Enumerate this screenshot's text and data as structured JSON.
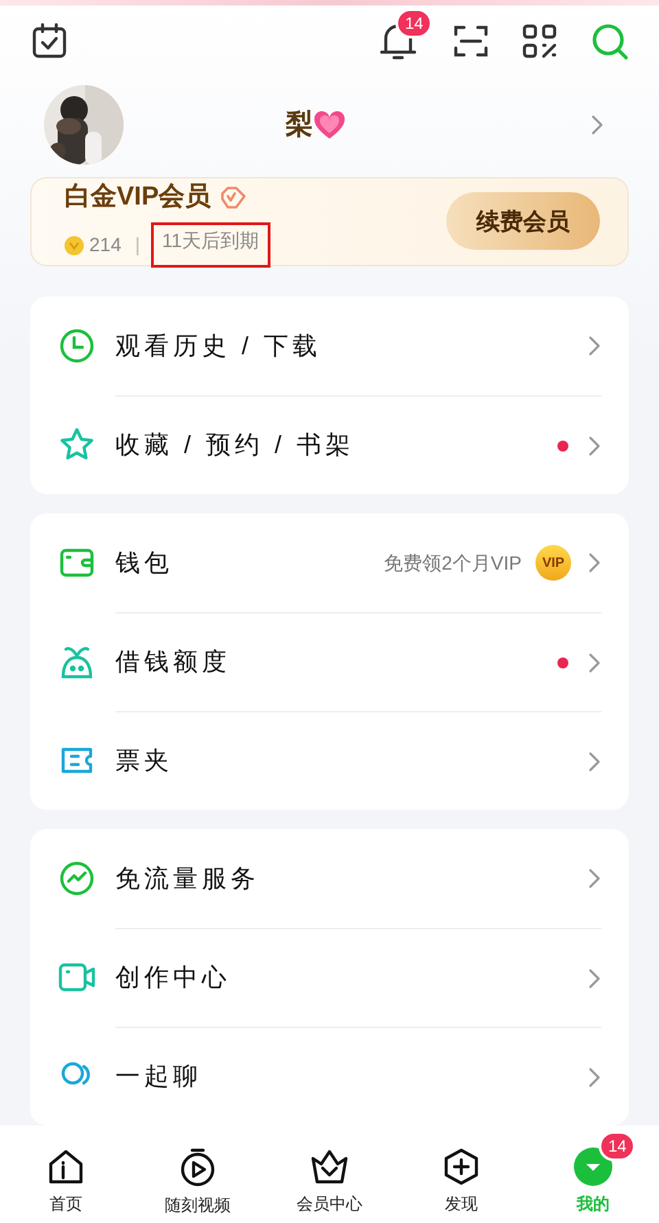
{
  "header": {
    "notification_badge": "14"
  },
  "profile": {
    "name": "梨"
  },
  "vip_card": {
    "title": "白金VIP会员",
    "points": "214",
    "separator": "|",
    "expiry": "11天后到期",
    "renew_button": "续费会员"
  },
  "menu_groups": [
    {
      "items": [
        {
          "label": "观看历史 / 下载",
          "dot": false
        },
        {
          "label": "收藏 / 预约 / 书架",
          "dot": true
        }
      ]
    },
    {
      "items": [
        {
          "label": "钱包",
          "dot": false,
          "hint": "免费领2个月VIP",
          "coin": "VIP"
        },
        {
          "label": "借钱额度",
          "dot": true
        },
        {
          "label": "票夹",
          "dot": false
        }
      ]
    },
    {
      "items": [
        {
          "label": "免流量服务",
          "dot": false
        },
        {
          "label": "创作中心",
          "dot": false
        },
        {
          "label": "一起聊",
          "dot": false
        }
      ]
    }
  ],
  "nav": [
    {
      "label": "首页",
      "selected": false
    },
    {
      "label": "随刻视频",
      "selected": false
    },
    {
      "label": "会员中心",
      "selected": false
    },
    {
      "label": "发现",
      "selected": false
    },
    {
      "label": "我的",
      "selected": true,
      "badge": "14"
    }
  ]
}
